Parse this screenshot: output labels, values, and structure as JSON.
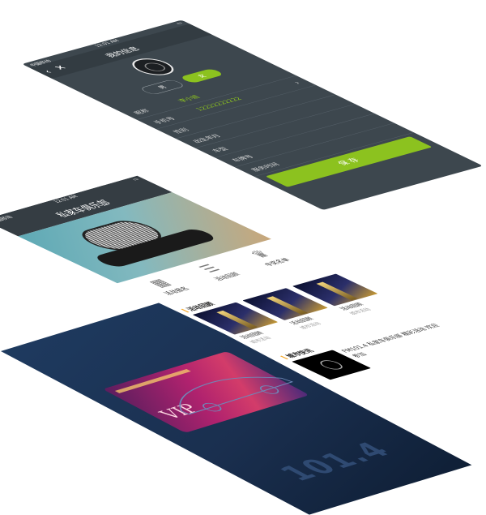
{
  "profile_screen": {
    "status": {
      "carrier": "中国移动",
      "time": "12:01 AM"
    },
    "nav": {
      "back_icon": "chevron-left-icon",
      "close_icon": "close-icon",
      "title": "我的信息"
    },
    "gender": {
      "male": "男",
      "female": "女"
    },
    "fields": [
      {
        "label": "昵称",
        "value": "李小姐"
      },
      {
        "label": "手机号",
        "value": "12222222222"
      },
      {
        "label": "性别",
        "value": ""
      },
      {
        "label": "出生年月",
        "value": ""
      },
      {
        "label": "车型",
        "value": ""
      },
      {
        "label": "车牌号",
        "value": ""
      },
      {
        "label": "服务时间",
        "value": ""
      }
    ],
    "save_label": "保 存",
    "accent_color": "#8cc21f"
  },
  "activity_screen": {
    "status": {
      "carrier": "中国移动",
      "time": "12:01 AM"
    },
    "title": "私家车俱乐部",
    "categories": [
      {
        "icon": "calendar-icon",
        "label": "活动报名"
      },
      {
        "icon": "document-icon",
        "label": "活动回顾"
      },
      {
        "icon": "cup-icon",
        "label": "中奖名单"
      }
    ],
    "section_recent": "活动回顾",
    "cards": [
      {
        "caption": "活动回顾",
        "location": "城市活动"
      },
      {
        "caption": "活动回顾",
        "location": "城市活动"
      },
      {
        "caption": "活动回顾",
        "location": "城市活动"
      }
    ],
    "section_news": "城市快讯",
    "news_text": "FM101.4 私家车俱乐部 精彩活动 欢迎参加"
  },
  "vip_screen": {
    "vip_label": "VIP",
    "frequency": "101.4"
  }
}
